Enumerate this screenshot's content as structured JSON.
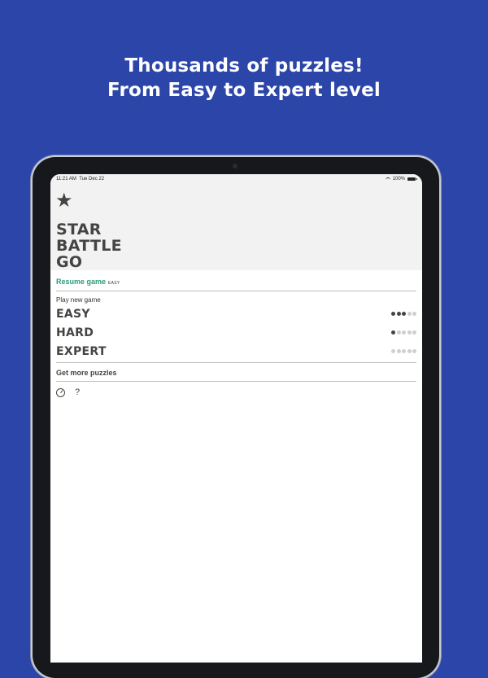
{
  "headline": {
    "line1": "Thousands of puzzles!",
    "line2": "From Easy to Expert level"
  },
  "status_bar": {
    "time": "11:21 AM",
    "date": "Tue Dec 22",
    "battery": "100%"
  },
  "app": {
    "icon": "star-icon",
    "title_lines": [
      "STAR",
      "BATTLE",
      "GO"
    ],
    "resume": {
      "label": "Resume game",
      "level": "EASY"
    },
    "play_new_label": "Play new game",
    "difficulties": [
      {
        "name": "EASY",
        "level": 3,
        "max": 5
      },
      {
        "name": "HARD",
        "level": 1,
        "max": 5
      },
      {
        "name": "EXPERT",
        "level": 0,
        "max": 5
      }
    ],
    "get_more_label": "Get more puzzles",
    "footer_icons": [
      "stats-gauge-icon",
      "help-question-icon"
    ],
    "help_symbol": "?"
  },
  "colors": {
    "background": "#2b45a8",
    "accent": "#2a9d7e",
    "text_dark": "#444444"
  }
}
